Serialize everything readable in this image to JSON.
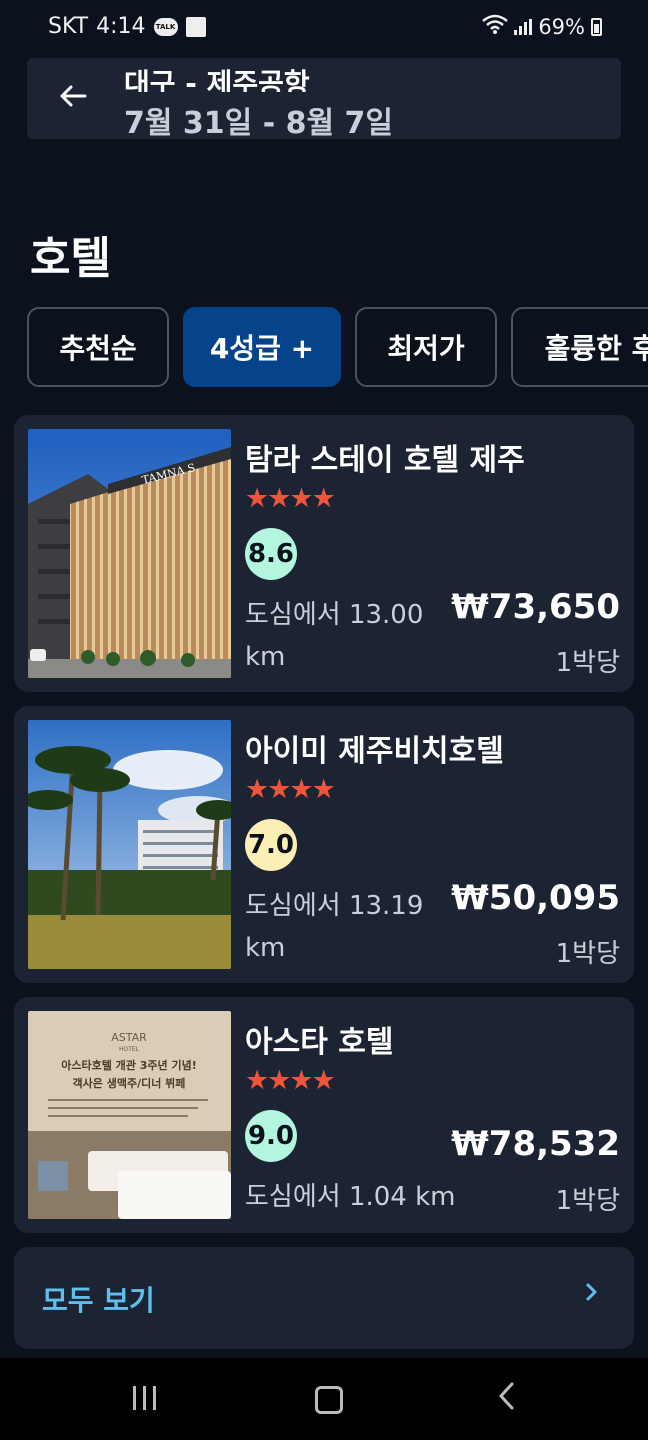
{
  "status_bar": {
    "carrier": "SKT",
    "time": "4:14",
    "talk_badge": "TALK",
    "battery": "69%",
    "icons": [
      "talk-icon",
      "note-icon",
      "wifi-icon",
      "signal-icon",
      "battery-icon"
    ]
  },
  "header": {
    "back_icon": "arrow-left-icon",
    "route": "대구 - 제주공항",
    "dates": "7월 31일 - 8월 7일"
  },
  "section_title": "호텔",
  "filters": [
    {
      "label": "추천순",
      "active": false
    },
    {
      "label": "4성급 +",
      "active": true
    },
    {
      "label": "최저가",
      "active": false
    },
    {
      "label": "훌륭한 후",
      "active": false
    }
  ],
  "hotels": [
    {
      "name": "탐라 스테이 호텔 제주",
      "stars": "★★★★",
      "rating": "8.6",
      "rating_color": "#b4f5df",
      "distance": "도심에서 13.00 km",
      "price": "₩73,650",
      "per_night": "1박당",
      "sign_text": "TAMNA S"
    },
    {
      "name": "아이미 제주비치호텔",
      "stars": "★★★★",
      "rating": "7.0",
      "rating_color": "#fdeeb3",
      "distance": "도심에서 13.19 km",
      "price": "₩50,095",
      "per_night": "1박당"
    },
    {
      "name": "아스타 호텔",
      "stars": "★★★★",
      "rating": "9.0",
      "rating_color": "#b4f5df",
      "distance": "도심에서 1.04 km",
      "price": "₩78,532",
      "per_night": "1박당",
      "ad_brand": "ASTAR",
      "ad_sub": "HOTEL",
      "ad_line1": "아스타호텔 개관 3주년 기념!",
      "ad_line2": "객사은 생맥주/디너 뷔페"
    }
  ],
  "see_all": {
    "label": "모두 보기",
    "icon": "chevron-right-icon"
  },
  "nav_bar": {
    "icons": [
      "recents-icon",
      "home-icon",
      "back-icon"
    ]
  }
}
